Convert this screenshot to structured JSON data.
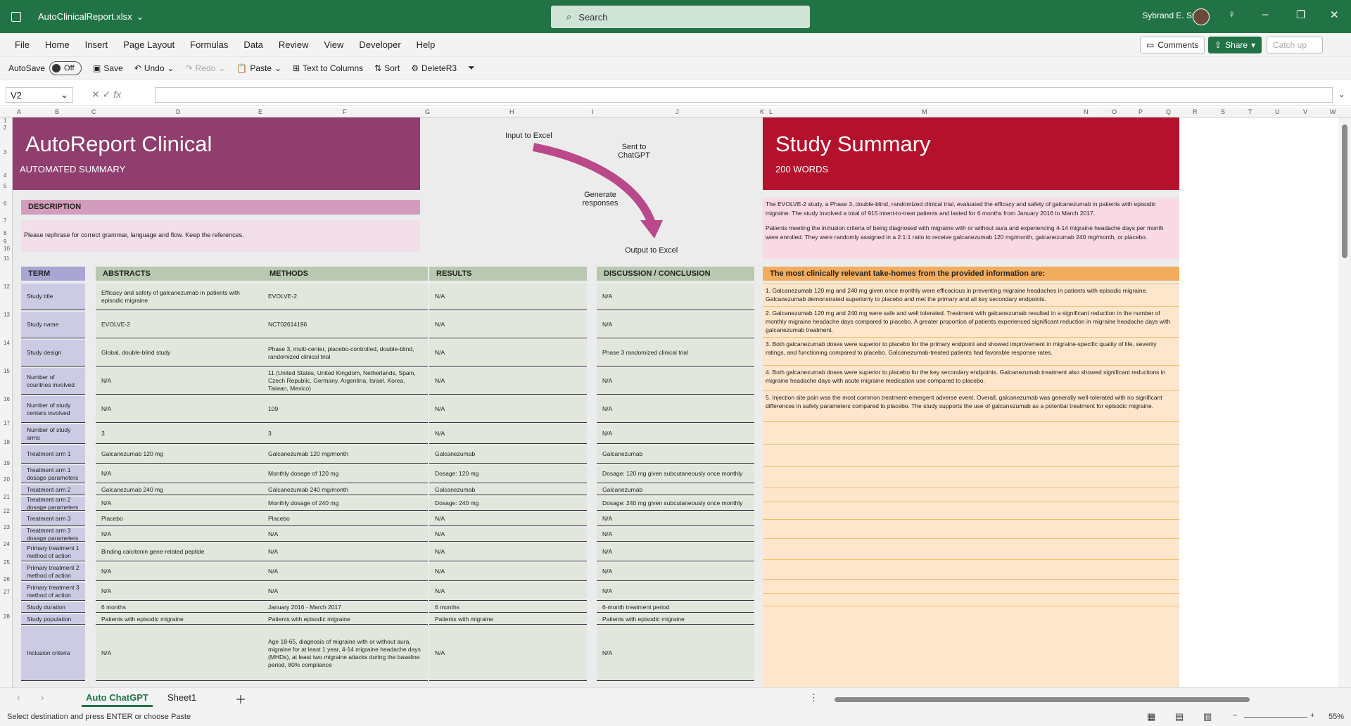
{
  "app": {
    "filename": "AutoClinicalReport.xlsx",
    "search_placeholder": "Search",
    "user": "Sybrand E. Smit"
  },
  "menu": [
    "File",
    "Home",
    "Insert",
    "Page Layout",
    "Formulas",
    "Data",
    "Review",
    "View",
    "Developer",
    "Help"
  ],
  "menu_buttons": {
    "comments": "Comments",
    "share": "Share",
    "catchup": "Catch up"
  },
  "qat": {
    "autosave": "AutoSave",
    "autosave_state": "Off",
    "save": "Save",
    "undo": "Undo",
    "redo": "Redo",
    "paste": "Paste",
    "text_to_columns": "Text to Columns",
    "sort": "Sort",
    "macro": "DeleteR3"
  },
  "formula": {
    "namebox": "V2",
    "fx": "fx",
    "value": ""
  },
  "columns": [
    "A",
    "B",
    "C",
    "D",
    "E",
    "F",
    "G",
    "H",
    "I",
    "J",
    "K",
    "L",
    "M",
    "N",
    "O",
    "P",
    "Q",
    "R",
    "S",
    "T",
    "U",
    "V",
    "W"
  ],
  "rows": [
    "1",
    "2",
    "3",
    "4",
    "5",
    "6",
    "7",
    "8",
    "9",
    "10",
    "11",
    "12",
    "13",
    "14",
    "15",
    "16",
    "17",
    "18",
    "19",
    "20",
    "21",
    "22",
    "23",
    "24",
    "25",
    "26",
    "27",
    "28"
  ],
  "left_header": {
    "title": "AutoReport Clinical",
    "subtitle": "AUTOMATED SUMMARY"
  },
  "right_header": {
    "title": "Study Summary",
    "subtitle": "200 WORDS"
  },
  "description": {
    "label": "DESCRIPTION",
    "text": "Please rephrase for correct grammar, language and flow. Keep the references."
  },
  "flow": {
    "input": "Input to Excel",
    "sent": "Sent to ChatGPT",
    "generate": "Generate responses",
    "output": "Output to Excel"
  },
  "summary_paragraphs": [
    "The EVOLVE-2 study, a Phase 3, double-blind, randomized clinical trial, evaluated the efficacy and safety of galcanezumab in patients with episodic migraine. The study involved a total of 915 intent-to-treat patients and lasted for 6 months from January 2016 to March 2017.",
    "Patients meeting the inclusion criteria of being diagnosed with migraine with or without aura and experiencing 4-14 migraine headache days per month were enrolled. They were randomly assigned in a 2:1:1 ratio to receive galcanezumab 120 mg/month, galcanezumab 240 mg/month, or placebo."
  ],
  "table_headers": [
    "TERM",
    "ABSTRACTS",
    "METHODS",
    "RESULTS",
    "DISCUSSION / CONCLUSION"
  ],
  "takehomes_header": "The most clinically relevant take-homes from the provided information are:",
  "takehomes": [
    "1. Galcanezumab 120 mg and 240 mg given once monthly were efficacious in preventing migraine headaches in patients with episodic migraine. Galcanezumab demonstrated superiority to placebo and met the primary and all key secondary endpoints.",
    "2. Galcanezumab 120 mg and 240 mg were safe and well tolerated. Treatment with galcanezumab resulted in a significant reduction in the number of monthly migraine headache days compared to placebo. A greater proportion of patients experienced significant reduction in migraine headache days with galcanezumab treatment.",
    "3. Both galcanezumab doses were superior to placebo for the primary endpoint and showed improvement in migraine-specific quality of life, severity ratings, and functioning compared to placebo. Galcanezumab-treated patients had favorable response rates.",
    "4. Both galcanezumab doses were superior to placebo for the key secondary endpoints. Galcanezumab treatment also showed significant reductions in migraine headache days with acute migraine medication use compared to placebo.",
    "5. Injection site pain was the most common treatment-emergent adverse event. Overall, galcanezumab was generally well-tolerated with no significant differences in safety parameters compared to placebo. The study supports the use of galcanezumab as a potential treatment for episodic migraine."
  ],
  "table_rows": [
    [
      "Study title",
      "Efficacy and safety of galcanezumab in patients with episodic migraine",
      "EVOLVE-2",
      "N/A",
      "N/A"
    ],
    [
      "Study name",
      "EVOLVE-2",
      "NCT02614196",
      "N/A",
      "N/A"
    ],
    [
      "Study design",
      "Global, double-blind study",
      "Phase 3, multi-center, placebo-controlled, double-blind, randomized clinical trial",
      "N/A",
      "Phase 3 randomized clinical trial"
    ],
    [
      "Number of countries involved",
      "N/A",
      "11 (United States, United Kingdom, Netherlands, Spain, Czech Republic, Germany, Argentina, Israel, Korea, Taiwan, Mexico)",
      "N/A",
      "N/A"
    ],
    [
      "Number of study centers involved",
      "N/A",
      "109",
      "N/A",
      "N/A"
    ],
    [
      "Number of study arms",
      "3",
      "3",
      "N/A",
      "N/A"
    ],
    [
      "Treatment arm 1",
      "Galcanezumab 120 mg",
      "Galcanezumab 120 mg/month",
      "Galcanezumab",
      "Galcanezumab"
    ],
    [
      "Treatment arm 1 dosage parameters",
      "N/A",
      "Monthly dosage of 120 mg",
      "Dosage: 120 mg",
      "Dosage: 120 mg given subcutaneously once monthly"
    ],
    [
      "Treatment arm 2",
      "Galcanezumab 240 mg",
      "Galcanezumab 240 mg/month",
      "Galcanezumab",
      "Galcanezumab"
    ],
    [
      "Treatment arm 2 dosage parameters",
      "N/A",
      "Monthly dosage of 240 mg",
      "Dosage: 240 mg",
      "Dosage: 240 mg given subcutaneously once monthly"
    ],
    [
      "Treatment arm 3",
      "Placebo",
      "Placebo",
      "N/A",
      "N/A"
    ],
    [
      "Treatment arm 3 dosage parameters",
      "N/A",
      "N/A",
      "N/A",
      "N/A"
    ],
    [
      "Primary treatment 1 method of action",
      "Binding calcitonin gene-related peptide",
      "N/A",
      "N/A",
      "N/A"
    ],
    [
      "Primary treatment 2 method of action",
      "N/A",
      "N/A",
      "N/A",
      "N/A"
    ],
    [
      "Primary treatment 3 method of action",
      "N/A",
      "N/A",
      "N/A",
      "N/A"
    ],
    [
      "Study duration",
      "6 months",
      "January 2016 - March 2017",
      "6 months",
      "6-month treatment period"
    ],
    [
      "Study population",
      "Patients with episodic migraine",
      "Patients with episodic migraine",
      "Patients with migraine",
      "Patients with episodic migraine"
    ],
    [
      "Inclusion criteria",
      "N/A",
      "Age 18-65, diagnosis of migraine with or without aura, migraine for at least 1 year, 4-14 migraine headache days (MHDs), at least two migraine attacks during the baseline period, 80% compliance",
      "N/A",
      "N/A"
    ]
  ],
  "sheets": [
    "Auto ChatGPT",
    "Sheet1"
  ],
  "status": {
    "text": "Select destination and press ENTER or choose Paste",
    "zoom": "55%"
  }
}
